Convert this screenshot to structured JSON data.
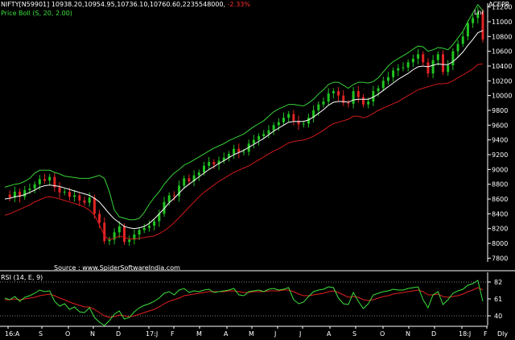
{
  "header": {
    "symbol": "NIFTY[N59901]",
    "ohlc": "10938.20,10954.95,10736.10,10760.60,",
    "volume": "2235548000,",
    "change": "-2.33%",
    "indicator": "Price Boll (S, 20, 2.00)",
    "brand": "ACEPR",
    "scale": "Lnr",
    "source": "Source : www.SpiderSoftwareIndia.com"
  },
  "rsi_panel": {
    "label": "RSI (14, E, 9)",
    "ticks": [
      "82",
      "61",
      "40"
    ]
  },
  "colors": {
    "background": "#000000",
    "up_candle": "#21c421",
    "down_candle": "#e22424",
    "upper_band": "#37d237",
    "lower_band": "#d01a1a",
    "middle_band": "#ffffff",
    "rsi_line": "#3be23b",
    "rsi_signal": "#e02020",
    "axis": "#ffffff"
  },
  "chart_data": {
    "type": "line",
    "title": "",
    "xlabel": "",
    "ylabel": "",
    "ylim": [
      7750,
      11250
    ],
    "y_ticks": [
      7800,
      8000,
      8200,
      8400,
      8600,
      8800,
      9000,
      9200,
      9400,
      9600,
      9800,
      10000,
      10200,
      10400,
      10600,
      10800,
      11000,
      11200
    ],
    "x_tick_labels": [
      "16:A",
      "S",
      "O",
      "N",
      "D",
      "17:J",
      "F",
      "M",
      "A",
      "M",
      "J",
      "J",
      "A",
      "S",
      "O",
      "N",
      "D",
      "18:J",
      "F",
      "Dly"
    ],
    "grid": false,
    "series": [
      {
        "name": "Price",
        "values": [
          8660,
          8620,
          8700,
          8630,
          8720,
          8740,
          8800,
          8870,
          8850,
          8900,
          8760,
          8690,
          8700,
          8630,
          8650,
          8580,
          8550,
          8620,
          8400,
          8280,
          8030,
          8050,
          8150,
          8230,
          8020,
          8050,
          8120,
          8180,
          8210,
          8240,
          8300,
          8400,
          8560,
          8650,
          8640,
          8780,
          8880,
          8840,
          8920,
          8960,
          9050,
          9100,
          9070,
          9120,
          9160,
          9210,
          9280,
          9230,
          9240,
          9350,
          9400,
          9450,
          9480,
          9530,
          9600,
          9640,
          9700,
          9750,
          9660,
          9610,
          9620,
          9700,
          9800,
          9880,
          9920,
          10030,
          10060,
          10000,
          9900,
          9890,
          10060,
          9980,
          9880,
          9920,
          10060,
          10100,
          10200,
          10250,
          10340,
          10370,
          10380,
          10450,
          10500,
          10560,
          10450,
          10300,
          10480,
          10560,
          10320,
          10410,
          10600,
          10700,
          10800,
          10980,
          11050,
          11130,
          10760
        ]
      },
      {
        "name": "Upper Band",
        "values": [
          8760,
          8780,
          8800,
          8810,
          8840,
          8880,
          8950,
          8990,
          8990,
          8990,
          8960,
          8940,
          8910,
          8900,
          8890,
          8880,
          8880,
          8880,
          8900,
          8920,
          8880,
          8700,
          8450,
          8360,
          8340,
          8320,
          8320,
          8340,
          8420,
          8530,
          8620,
          8700,
          8800,
          8880,
          8950,
          9000,
          9060,
          9090,
          9130,
          9170,
          9210,
          9250,
          9290,
          9320,
          9350,
          9390,
          9420,
          9450,
          9480,
          9530,
          9580,
          9620,
          9660,
          9720,
          9780,
          9820,
          9850,
          9880,
          9880,
          9870,
          9860,
          9900,
          9950,
          10020,
          10080,
          10150,
          10180,
          10180,
          10140,
          10100,
          10150,
          10180,
          10180,
          10170,
          10190,
          10240,
          10320,
          10400,
          10460,
          10500,
          10540,
          10580,
          10630,
          10670,
          10660,
          10600,
          10620,
          10650,
          10640,
          10620,
          10690,
          10780,
          10870,
          11000,
          11120,
          11230,
          11150
        ]
      },
      {
        "name": "Middle Band",
        "values": [
          8600,
          8610,
          8630,
          8640,
          8660,
          8690,
          8720,
          8760,
          8780,
          8790,
          8780,
          8770,
          8750,
          8730,
          8710,
          8690,
          8670,
          8650,
          8610,
          8560,
          8480,
          8400,
          8330,
          8280,
          8230,
          8210,
          8200,
          8210,
          8230,
          8270,
          8330,
          8400,
          8470,
          8550,
          8610,
          8680,
          8750,
          8800,
          8850,
          8900,
          8950,
          9000,
          9040,
          9080,
          9120,
          9160,
          9200,
          9230,
          9260,
          9300,
          9340,
          9380,
          9420,
          9470,
          9520,
          9560,
          9600,
          9640,
          9650,
          9650,
          9650,
          9670,
          9710,
          9760,
          9810,
          9870,
          9910,
          9920,
          9920,
          9910,
          9940,
          9950,
          9950,
          9950,
          9980,
          10020,
          10070,
          10120,
          10170,
          10220,
          10260,
          10300,
          10350,
          10390,
          10400,
          10390,
          10410,
          10430,
          10420,
          10420,
          10460,
          10520,
          10590,
          10680,
          10760,
          10850,
          10880
        ]
      },
      {
        "name": "Lower Band",
        "values": [
          8380,
          8400,
          8430,
          8460,
          8490,
          8520,
          8560,
          8590,
          8620,
          8630,
          8620,
          8600,
          8580,
          8560,
          8540,
          8520,
          8490,
          8450,
          8380,
          8250,
          8100,
          8050,
          8070,
          8100,
          8080,
          8060,
          8060,
          8070,
          8080,
          8090,
          8100,
          8130,
          8170,
          8220,
          8280,
          8350,
          8420,
          8490,
          8560,
          8630,
          8690,
          8740,
          8790,
          8840,
          8880,
          8920,
          8960,
          8990,
          9020,
          9050,
          9090,
          9130,
          9170,
          9210,
          9250,
          9280,
          9320,
          9360,
          9380,
          9390,
          9400,
          9420,
          9450,
          9490,
          9530,
          9580,
          9620,
          9640,
          9660,
          9680,
          9720,
          9720,
          9700,
          9720,
          9760,
          9800,
          9830,
          9860,
          9890,
          9920,
          9960,
          10000,
          10040,
          10080,
          10100,
          10120,
          10140,
          10160,
          10160,
          10170,
          10200,
          10240,
          10280,
          10320,
          10360,
          10420,
          10430
        ]
      }
    ],
    "rsi": {
      "ylim": [
        30,
        92
      ],
      "levels": [
        82,
        61,
        40
      ],
      "label": "RSI (14, E, 9)",
      "values": [
        62,
        60,
        64,
        58,
        63,
        65,
        68,
        72,
        70,
        71,
        58,
        52,
        55,
        48,
        51,
        45,
        44,
        50,
        38,
        32,
        28,
        34,
        42,
        46,
        36,
        38,
        45,
        50,
        53,
        55,
        58,
        62,
        68,
        70,
        66,
        72,
        74,
        69,
        71,
        70,
        72,
        73,
        69,
        70,
        71,
        72,
        74,
        66,
        65,
        70,
        71,
        72,
        70,
        73,
        74,
        72,
        73,
        75,
        60,
        55,
        57,
        64,
        70,
        72,
        73,
        76,
        75,
        62,
        55,
        54,
        69,
        58,
        49,
        55,
        66,
        68,
        70,
        71,
        73,
        72,
        72,
        74,
        75,
        76,
        60,
        50,
        66,
        70,
        54,
        60,
        68,
        71,
        73,
        78,
        80,
        84,
        58
      ],
      "signal": [
        60,
        60,
        61,
        60,
        61,
        62,
        63,
        65,
        66,
        67,
        65,
        62,
        60,
        57,
        55,
        53,
        51,
        51,
        48,
        44,
        40,
        38,
        39,
        41,
        40,
        39,
        40,
        42,
        44,
        46,
        48,
        51,
        55,
        58,
        60,
        62,
        65,
        66,
        67,
        68,
        69,
        70,
        70,
        70,
        70,
        71,
        71,
        70,
        69,
        69,
        70,
        70,
        70,
        71,
        71,
        71,
        72,
        72,
        70,
        67,
        65,
        65,
        66,
        67,
        68,
        70,
        71,
        69,
        66,
        63,
        64,
        63,
        60,
        59,
        60,
        62,
        64,
        65,
        67,
        68,
        69,
        70,
        71,
        72,
        70,
        66,
        66,
        67,
        64,
        63,
        64,
        65,
        67,
        70,
        72,
        75,
        72
      ]
    }
  }
}
